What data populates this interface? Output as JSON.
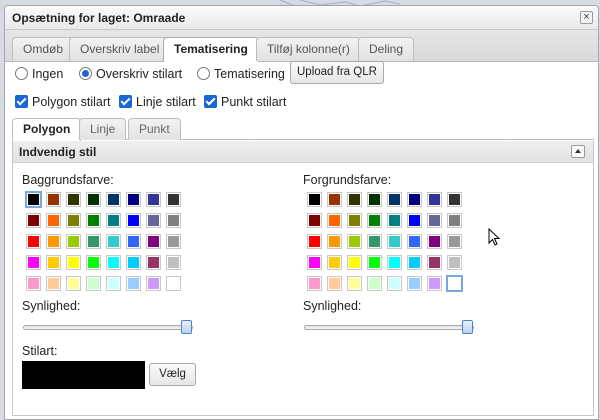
{
  "dialog": {
    "title": "Opsætning for laget: Omraade",
    "close_glyph": "×"
  },
  "tabs": [
    {
      "label": "Omdøb",
      "active": false
    },
    {
      "label": "Overskriv label",
      "active": false
    },
    {
      "label": "Tematisering",
      "active": true
    },
    {
      "label": "Tilføj kolonne(r)",
      "active": false
    },
    {
      "label": "Deling",
      "active": false
    }
  ],
  "style_mode": {
    "options": [
      {
        "label": "Ingen",
        "checked": false
      },
      {
        "label": "Overskriv stilart",
        "checked": true
      },
      {
        "label": "Tematisering",
        "checked": false
      }
    ],
    "upload_button": "Upload fra QLR"
  },
  "style_toggles": [
    {
      "label": "Polygon stilart",
      "checked": true
    },
    {
      "label": "Linje stilart",
      "checked": true
    },
    {
      "label": "Punkt stilart",
      "checked": true
    }
  ],
  "subtabs": [
    {
      "label": "Polygon",
      "active": true
    },
    {
      "label": "Linje",
      "active": false
    },
    {
      "label": "Punkt",
      "active": false
    }
  ],
  "panel": {
    "title": "Indvendig stil",
    "background_label": "Baggrundsfarve:",
    "foreground_label": "Forgrundsfarve:",
    "opacity_label": "Synlighed:",
    "style_label": "Stilart:",
    "choose_button": "Vælg",
    "background_opacity": 1.0,
    "foreground_opacity": 1.0,
    "background_selected": "#000000",
    "foreground_selected": "#ffffff",
    "style_preview_color": "#000000"
  },
  "palette": [
    [
      "#000000",
      "#993300",
      "#333300",
      "#003300",
      "#003366",
      "#000080",
      "#333399",
      "#333333"
    ],
    [
      "#800000",
      "#ff6600",
      "#808000",
      "#008000",
      "#008080",
      "#0000ff",
      "#666699",
      "#808080"
    ],
    [
      "#ff0000",
      "#ff9900",
      "#99cc00",
      "#339966",
      "#33cccc",
      "#3366ff",
      "#800080",
      "#999999"
    ],
    [
      "#ff00ff",
      "#ffcc00",
      "#ffff00",
      "#00ff00",
      "#00ffff",
      "#00ccff",
      "#993366",
      "#c0c0c0"
    ],
    [
      "#ff99cc",
      "#ffcc99",
      "#ffff99",
      "#ccffcc",
      "#ccffff",
      "#99ccff",
      "#cc99ff",
      "#ffffff"
    ]
  ],
  "colors": {
    "accent": "#1a66d6",
    "dialog_bg": "#ffffff",
    "header_bg": "#e9e9e9"
  }
}
